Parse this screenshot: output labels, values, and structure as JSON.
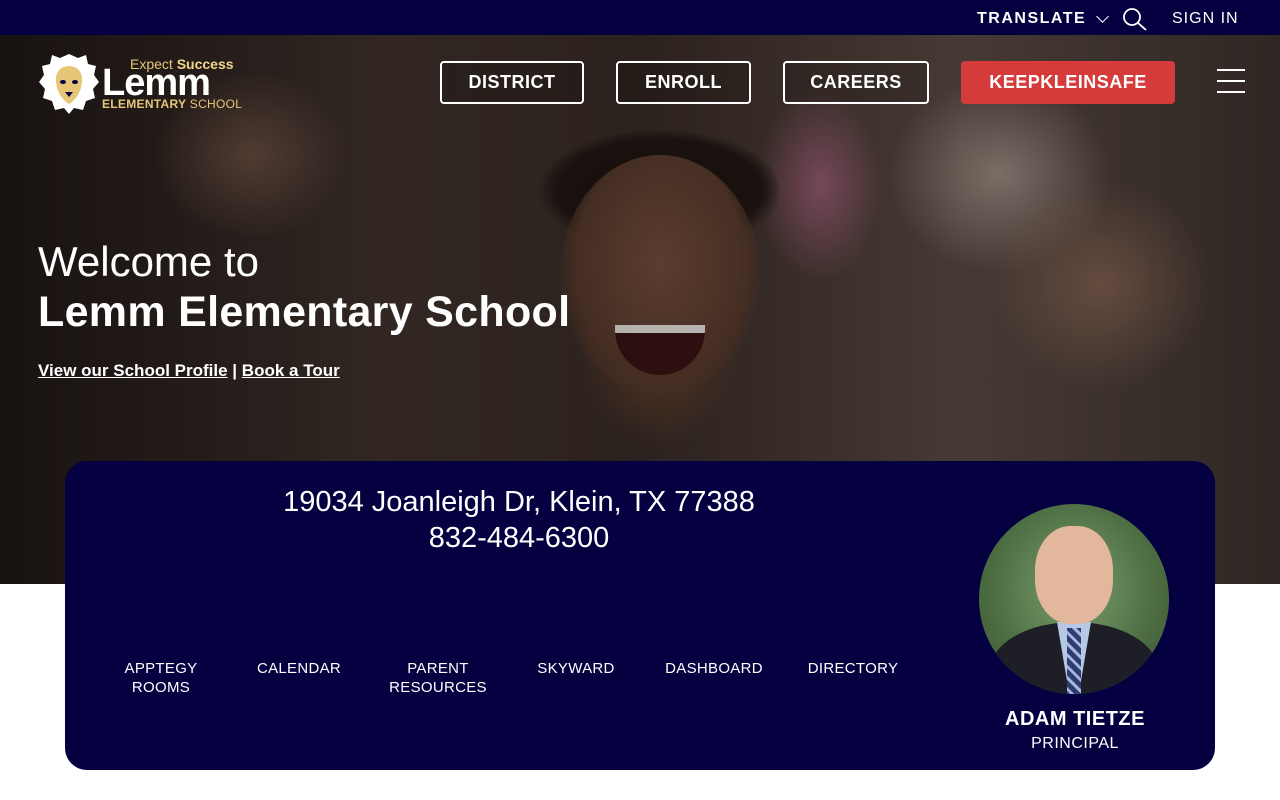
{
  "topbar": {
    "translate_label": "TRANSLATE",
    "signin_label": "SIGN IN"
  },
  "logo": {
    "tagline_prefix": "Expect ",
    "tagline_bold": "Success",
    "name": "Lemm",
    "subtitle_bold": "ELEMENTARY ",
    "subtitle_rest": "SCHOOL"
  },
  "nav": {
    "items": [
      {
        "label": "DISTRICT"
      },
      {
        "label": "ENROLL"
      },
      {
        "label": "CAREERS"
      },
      {
        "label": "KEEPKLEINSAFE"
      }
    ]
  },
  "hero": {
    "welcome": "Welcome to",
    "school_name": "Lemm Elementary School",
    "link_profile": "View our School Profile",
    "separator": "|",
    "link_tour": "Book a Tour"
  },
  "info": {
    "address": "19034 Joanleigh Dr, Klein, TX 77388",
    "phone": "832-484-6300"
  },
  "quick_links": [
    {
      "label": "APPTEGY ROOMS"
    },
    {
      "label": "CALENDAR"
    },
    {
      "label": "PARENT RESOURCES"
    },
    {
      "label": "SKYWARD"
    },
    {
      "label": "DASHBOARD"
    },
    {
      "label": "DIRECTORY"
    }
  ],
  "principal": {
    "name": "ADAM TIETZE",
    "title": "PRINCIPAL"
  },
  "colors": {
    "navy": "#04003f",
    "accent_red": "#d63b3b",
    "gold": "#e7c678"
  }
}
